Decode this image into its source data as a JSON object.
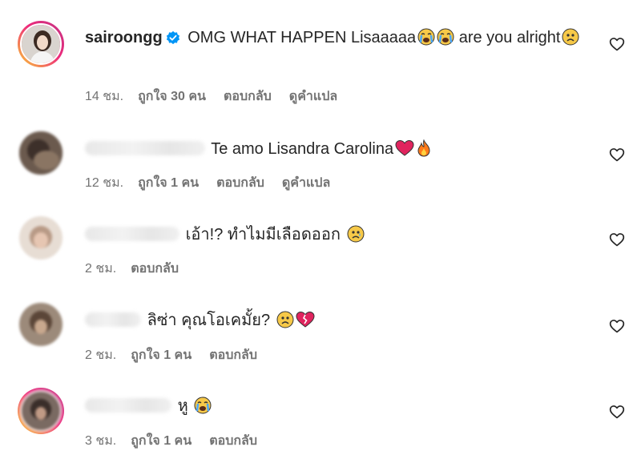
{
  "comments": [
    {
      "username": "sairoongg",
      "text_before": "OMG WHAT HAPPEN Lisaaaaa",
      "text_after": " are you alright",
      "time": "14 ชม.",
      "likes": "ถูกใจ 30 คน",
      "reply": "ตอบกลับ",
      "translate": "ดูคำแปล"
    },
    {
      "text": "Te amo Lisandra Carolina",
      "time": "12 ชม.",
      "likes": "ถูกใจ 1 คน",
      "reply": "ตอบกลับ",
      "translate": "ดูคำแปล"
    },
    {
      "text": "เอ้า!? ทำไมมีเลือดออก",
      "time": "2 ชม.",
      "reply": "ตอบกลับ"
    },
    {
      "text": "ลิซ่า คุณโอเคมั้ย?",
      "time": "2 ชม.",
      "likes": "ถูกใจ 1 คน",
      "reply": "ตอบกลับ"
    },
    {
      "text": "หู",
      "time": "3 ชม.",
      "likes": "ถูกใจ 1 คน",
      "reply": "ตอบกลับ"
    }
  ],
  "icons": {
    "verified": "verified-badge-icon",
    "heart": "heart-outline-icon",
    "emojis": [
      "loudly-crying-face",
      "frowning-face",
      "red-heart",
      "fire",
      "sad-relieved-face",
      "broken-heart"
    ]
  },
  "colors": {
    "verified_blue": "#0095f6",
    "meta_gray": "#737373",
    "text": "#262626"
  }
}
